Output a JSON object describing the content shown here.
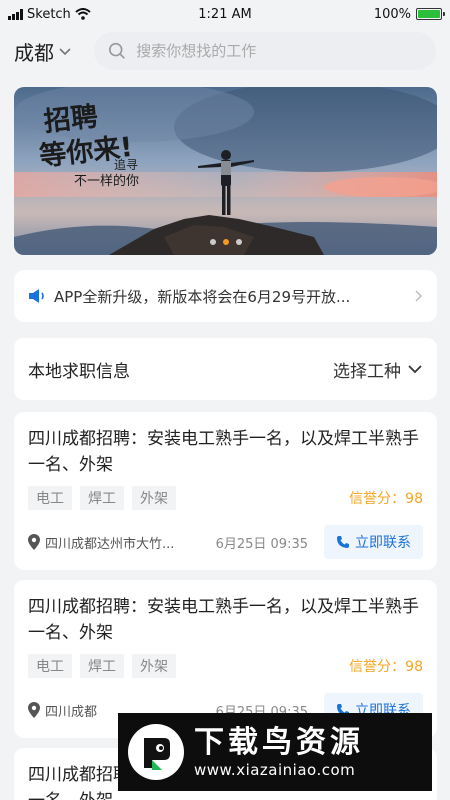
{
  "status_bar": {
    "carrier": "Sketch",
    "time": "1:21 AM",
    "battery": "100%"
  },
  "header": {
    "city": "成都",
    "search_placeholder": "搜索你想找的工作"
  },
  "banner": {
    "headline_line1": "招聘",
    "headline_line2": "等你来!",
    "slogan_line1": "追寻",
    "slogan_line2": "不一样的你",
    "dots": 3,
    "active_dot": 1
  },
  "notice": {
    "text": "APP全新升级，新版本将会在6月29号开放..."
  },
  "section": {
    "title": "本地求职信息",
    "filter_label": "选择工种"
  },
  "jobs": [
    {
      "title": "四川成都招聘：安装电工熟手一名，以及焊工半熟手一名、外架",
      "tags": [
        "电工",
        "焊工",
        "外架"
      ],
      "credit": "信誉分：98",
      "location": "四川成都达州市大竹...",
      "time": "6月25日 09:35",
      "contact_label": "立即联系"
    },
    {
      "title": "四川成都招聘：安装电工熟手一名，以及焊工半熟手一名、外架",
      "tags": [
        "电工",
        "焊工",
        "外架"
      ],
      "credit": "信誉分：98",
      "location": "四川成都",
      "time": "6月25日 09:35",
      "contact_label": "立即联系"
    },
    {
      "title": "四川成都招聘：安装电工熟手一名，以及焊工半熟手一名、外架"
    }
  ],
  "watermark": {
    "title": "下载鸟资源",
    "url": "www.xiazainiao.com"
  },
  "colors": {
    "accent": "#1a73d9",
    "credit": "#f5a623",
    "active_dot": "#f59a23"
  }
}
